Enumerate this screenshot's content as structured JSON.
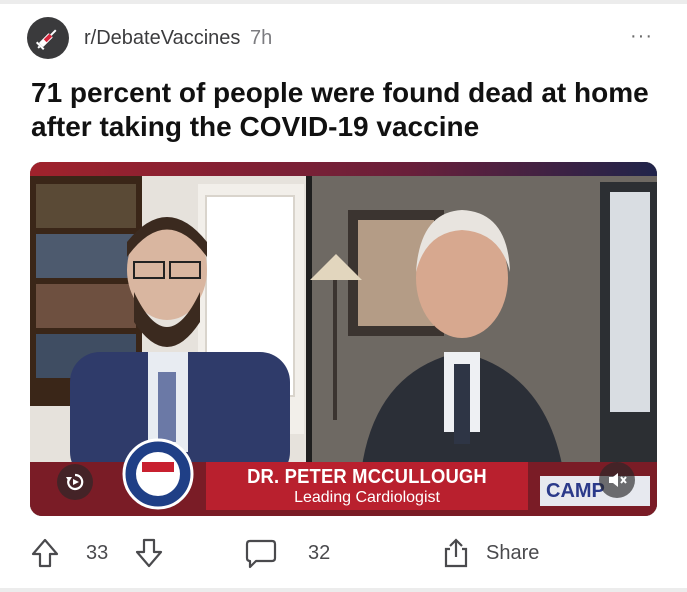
{
  "post": {
    "subreddit": "r/DebateVaccines",
    "age": "7h",
    "more_label": "···",
    "title": "71 percent of people were found dead at home after taking the COVID-19 vaccine",
    "subreddit_icon": "syringe-icon"
  },
  "video": {
    "lower_third_name": "DR. PETER MCCULLOUGH",
    "lower_third_role": "Leading Cardiologist",
    "channel_logo": "CAMP",
    "replay_icon": "replay-icon",
    "mute_icon": "mute-icon"
  },
  "actions": {
    "upvotes": "33",
    "comments": "32",
    "share_label": "Share"
  },
  "colors": {
    "lower_third_red": "#b9202e",
    "avatar_bg": "#3a3a3c",
    "text_gray": "#4a4a4d"
  }
}
